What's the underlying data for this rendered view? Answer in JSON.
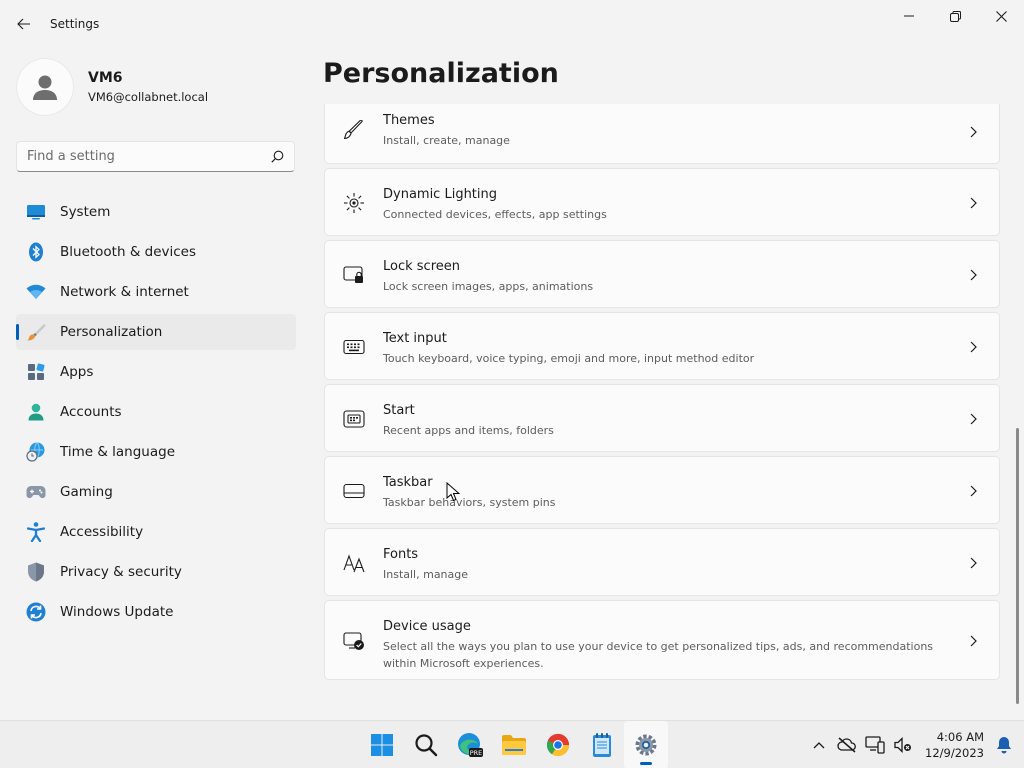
{
  "window": {
    "title": "Settings"
  },
  "profile": {
    "name": "VM6",
    "email": "VM6@collabnet.local"
  },
  "search": {
    "placeholder": "Find a setting"
  },
  "sidebar": {
    "items": [
      {
        "label": "System",
        "icon": "system-icon"
      },
      {
        "label": "Bluetooth & devices",
        "icon": "bluetooth-icon"
      },
      {
        "label": "Network & internet",
        "icon": "wifi-icon"
      },
      {
        "label": "Personalization",
        "icon": "brush-icon",
        "active": true
      },
      {
        "label": "Apps",
        "icon": "apps-icon"
      },
      {
        "label": "Accounts",
        "icon": "accounts-icon"
      },
      {
        "label": "Time & language",
        "icon": "globe-clock-icon"
      },
      {
        "label": "Gaming",
        "icon": "gamepad-icon"
      },
      {
        "label": "Accessibility",
        "icon": "accessibility-icon"
      },
      {
        "label": "Privacy & security",
        "icon": "shield-icon"
      },
      {
        "label": "Windows Update",
        "icon": "update-icon"
      }
    ]
  },
  "main": {
    "title": "Personalization",
    "cards": [
      {
        "title": "Themes",
        "desc": "Install, create, manage",
        "icon": "pen-icon"
      },
      {
        "title": "Dynamic Lighting",
        "desc": "Connected devices, effects, app settings",
        "icon": "lighting-icon"
      },
      {
        "title": "Lock screen",
        "desc": "Lock screen images, apps, animations",
        "icon": "lock-screen-icon"
      },
      {
        "title": "Text input",
        "desc": "Touch keyboard, voice typing, emoji and more, input method editor",
        "icon": "keyboard-icon"
      },
      {
        "title": "Start",
        "desc": "Recent apps and items, folders",
        "icon": "start-icon"
      },
      {
        "title": "Taskbar",
        "desc": "Taskbar behaviors, system pins",
        "icon": "taskbar-icon"
      },
      {
        "title": "Fonts",
        "desc": "Install, manage",
        "icon": "fonts-icon"
      },
      {
        "title": "Device usage",
        "desc": "Select all the ways you plan to use your device to get personalized tips, ads, and recommendations within Microsoft experiences.",
        "icon": "device-usage-icon"
      }
    ]
  },
  "taskbar": {
    "apps": [
      "windows-start-icon",
      "search-icon",
      "edge-icon",
      "file-explorer-icon",
      "chrome-icon",
      "notepad-icon",
      "settings-icon"
    ],
    "time": "4:06 AM",
    "date": "12/9/2023",
    "badge": "PRE"
  },
  "colors": {
    "accent": "#005fb8",
    "background": "#f3f3f3",
    "card": "#fbfbfb"
  }
}
